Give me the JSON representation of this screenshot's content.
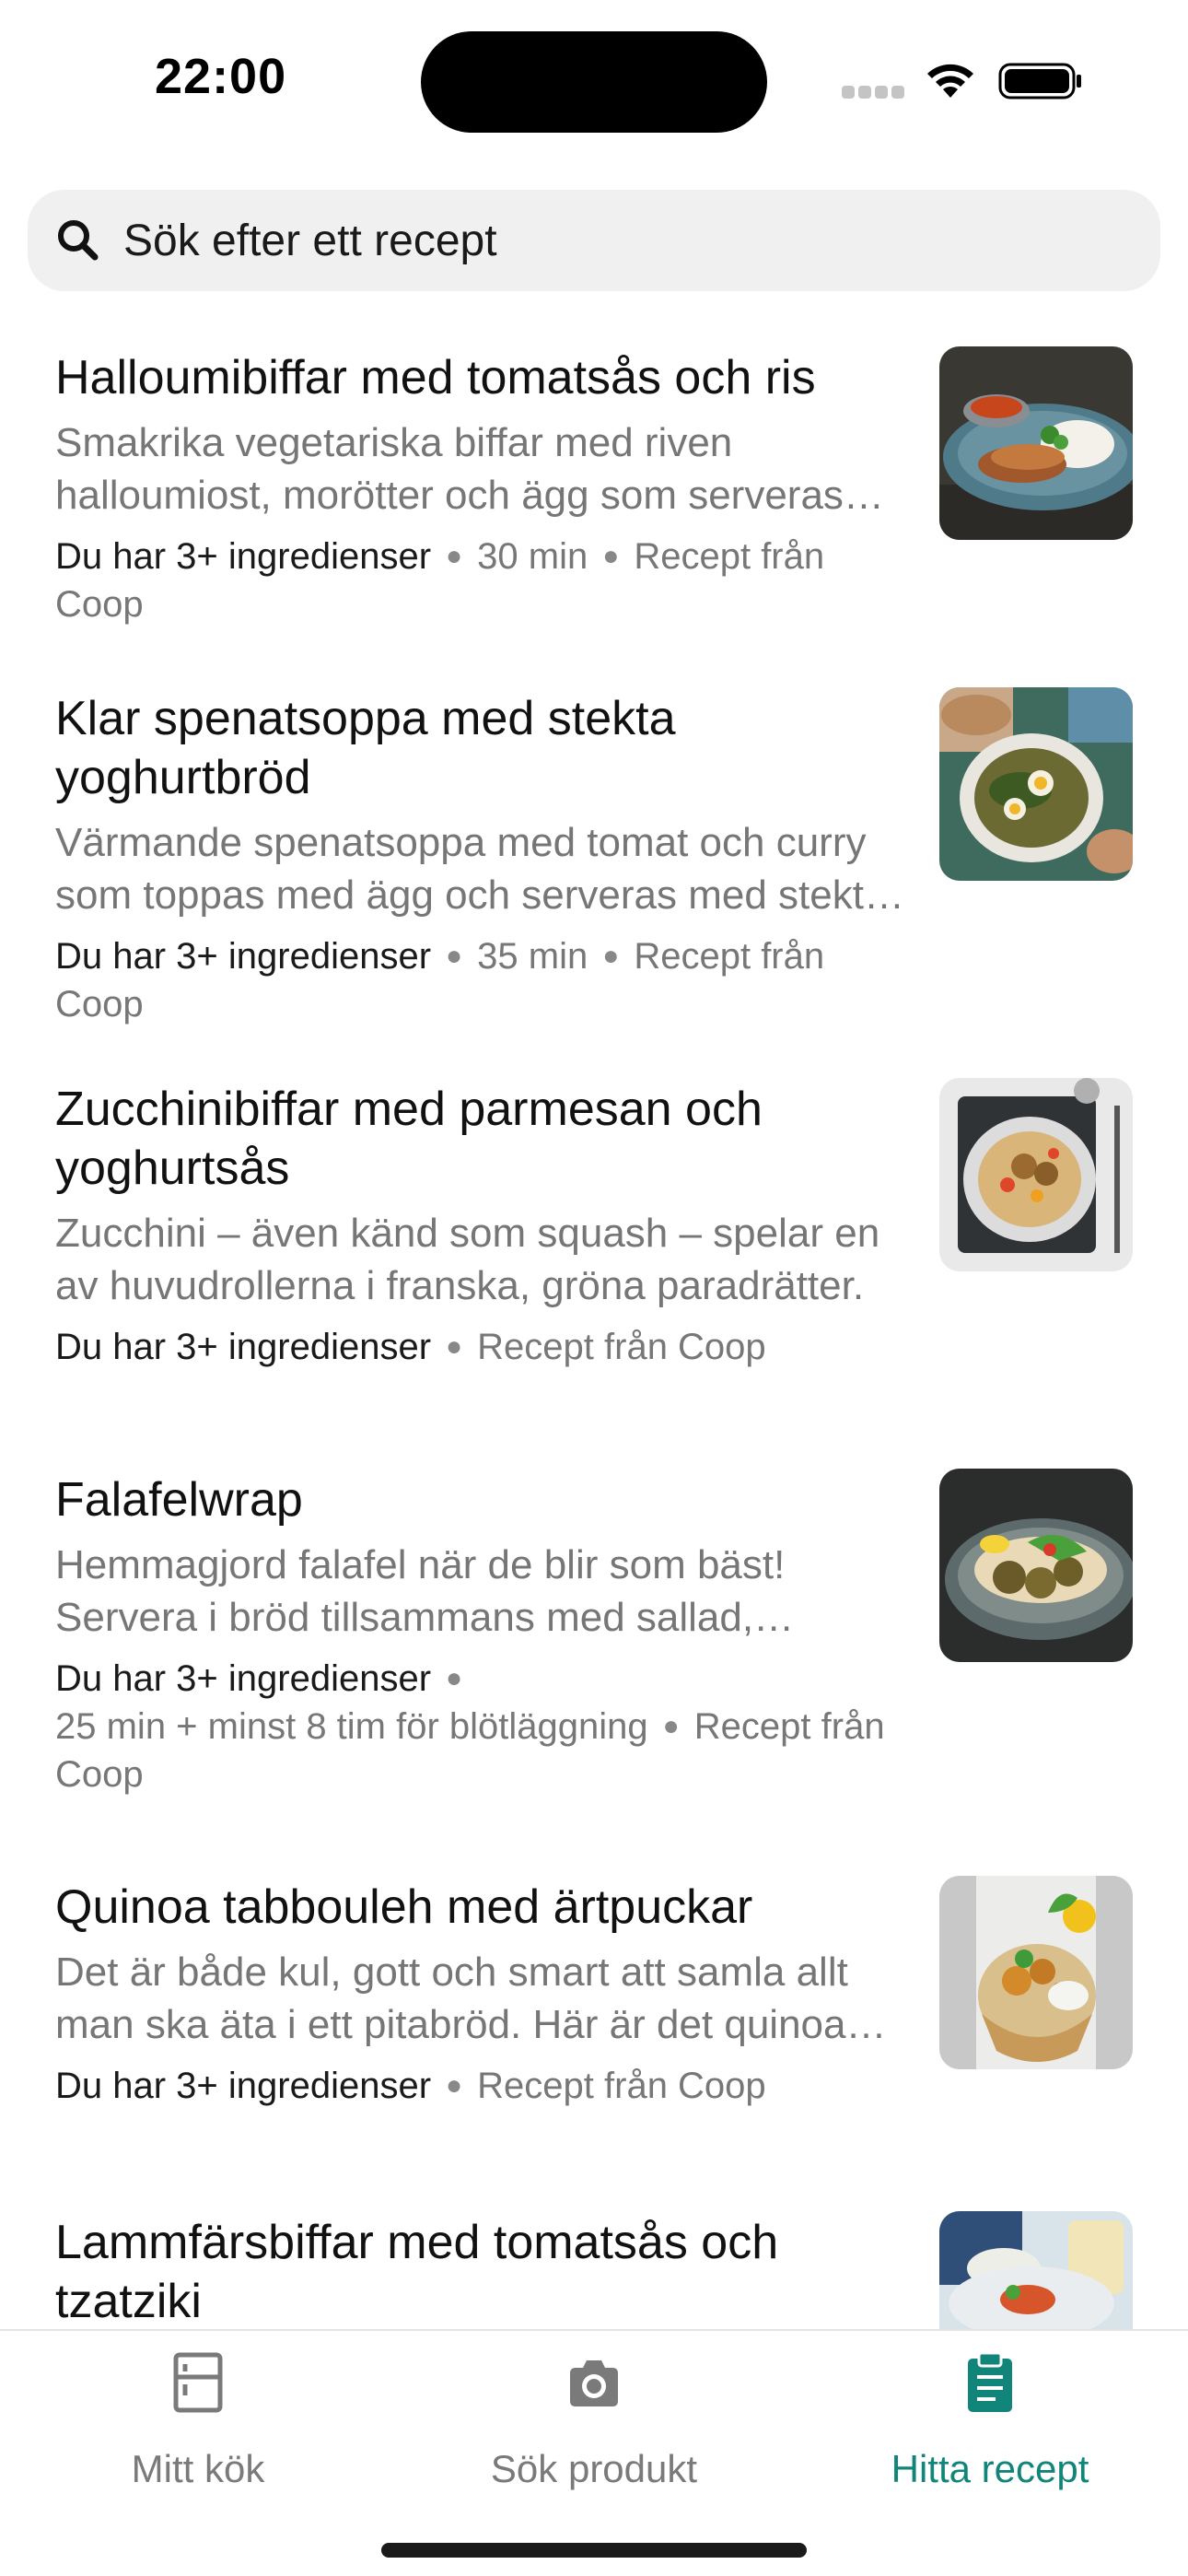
{
  "status_bar": {
    "time": "22:00"
  },
  "search": {
    "placeholder": "Sök efter ett recept"
  },
  "recipes": [
    {
      "title": "Halloumibiffar med tomatsås och ris",
      "description": "Smakrika vegetariska biffar med riven halloumiost, morötter och ägg som serveras med tomatsås och ris.",
      "ingredients": "Du har 3+ ingredienser",
      "time": "30 min",
      "source": "Recept från Coop",
      "image_icon": "food-photo"
    },
    {
      "title": "Klar spenatsoppa med stekta yoghurtbröd",
      "description": "Värmande spenatsoppa med tomat och curry som toppas med ägg och serveras med stekta yoghurtbröd.",
      "ingredients": "Du har 3+ ingredienser",
      "time": "35 min",
      "source": "Recept från Coop",
      "image_icon": "food-photo"
    },
    {
      "title": "Zucchinibiffar med parmesan och yoghurtsås",
      "description": "Zucchini – även känd som squash – spelar en av huvudrollerna i franska, gröna paradrätter.",
      "ingredients": "Du har 3+ ingredienser",
      "source": "Recept från Coop",
      "image_icon": "food-photo"
    },
    {
      "title": "Falafelwrap",
      "description": "Hemmagjord falafel när de blir som bäst! Servera i bröd tillsammans med sallad, yoghurtsås och tomat.",
      "ingredients": "Du har 3+ ingredienser",
      "time": "25 min + minst 8 tim för blötläggning",
      "source": "Recept från Coop",
      "image_icon": "food-photo"
    },
    {
      "title": "Quinoa tabbouleh med ärtpuckar",
      "description": "Det är både kul, gott och smart att samla allt man ska äta i ett pitabröd. Här är det quinoa och ärtpuckar.",
      "ingredients": "Du har 3+ ingredienser",
      "source": "Recept från Coop",
      "image_icon": "food-photo"
    },
    {
      "title": "Lammfärsbiffar med tomatsås och tzatziki",
      "image_icon": "food-photo"
    }
  ],
  "tabs": [
    {
      "label": "Mitt kök",
      "icon": "fridge-icon"
    },
    {
      "label": "Sök produkt",
      "icon": "camera-icon"
    },
    {
      "label": "Hitta recept",
      "icon": "clipboard-icon",
      "active": true
    }
  ],
  "colors": {
    "accent": "#12857a",
    "muted_text": "#767676",
    "search_bg": "#f0f0f0"
  }
}
